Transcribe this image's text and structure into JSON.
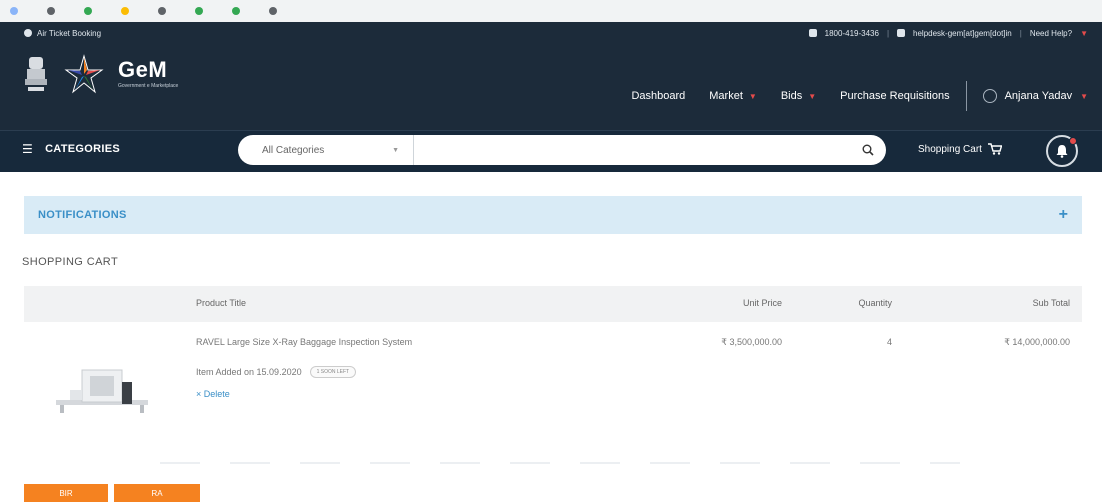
{
  "bookmarks": [
    {
      "label": "",
      "color": "#8ab4f8"
    },
    {
      "label": "",
      "color": "#5f6368"
    },
    {
      "label": "",
      "color": "#34a853"
    },
    {
      "label": "",
      "color": "#fbbc04"
    },
    {
      "label": "",
      "color": "#5f6368"
    },
    {
      "label": "",
      "color": "#34a853"
    },
    {
      "label": "",
      "color": "#34a853"
    },
    {
      "label": "",
      "color": "#5f6368"
    }
  ],
  "header": {
    "air_ticket": "Air Ticket Booking",
    "phone": "1800-419-3436",
    "email": "helpdesk-gem[at]gem[dot]in",
    "need_help": "Need Help?",
    "logo_text": "GeM",
    "logo_sub": "Government e Marketplace",
    "nav": {
      "dashboard": "Dashboard",
      "market": "Market",
      "bids": "Bids",
      "purchase_requisitions": "Purchase Requisitions"
    },
    "user_name": "Anjana Yadav"
  },
  "subnav": {
    "categories": "CATEGORIES",
    "search_select": "All Categories",
    "search_placeholder": "",
    "cart": "Shopping Cart"
  },
  "notifications": {
    "title": "NOTIFICATIONS",
    "toggle": "+"
  },
  "cart": {
    "heading": "SHOPPING CART",
    "columns": {
      "product_title": "Product Title",
      "unit_price": "Unit Price",
      "quantity": "Quantity",
      "sub_total": "Sub Total"
    },
    "items": [
      {
        "title": "RAVEL Large Size X-Ray Baggage Inspection System",
        "added": "Item Added on 15.09.2020",
        "badge": "1 SOON LEFT",
        "delete": "× Delete",
        "unit_price": "₹ 3,500,000.00",
        "quantity": "4",
        "sub_total": "₹ 14,000,000.00"
      }
    ]
  },
  "actions": {
    "button_1": "BIR",
    "button_2": "RA"
  },
  "colors": {
    "header_bg": "#1c2b3a",
    "subnav_bg": "#17293b",
    "accent_blue": "#3a8fc7",
    "notif_bg": "#d9ebf6",
    "button_orange": "#f58220",
    "alert_red": "#e44b4b"
  },
  "icons": {
    "emblem": "national-emblem-icon",
    "logo": "gem-star-logo",
    "user": "user-circle-icon",
    "search": "search-icon",
    "cart": "cart-icon",
    "bell": "bell-icon",
    "phone": "phone-icon",
    "mail": "mail-icon"
  }
}
